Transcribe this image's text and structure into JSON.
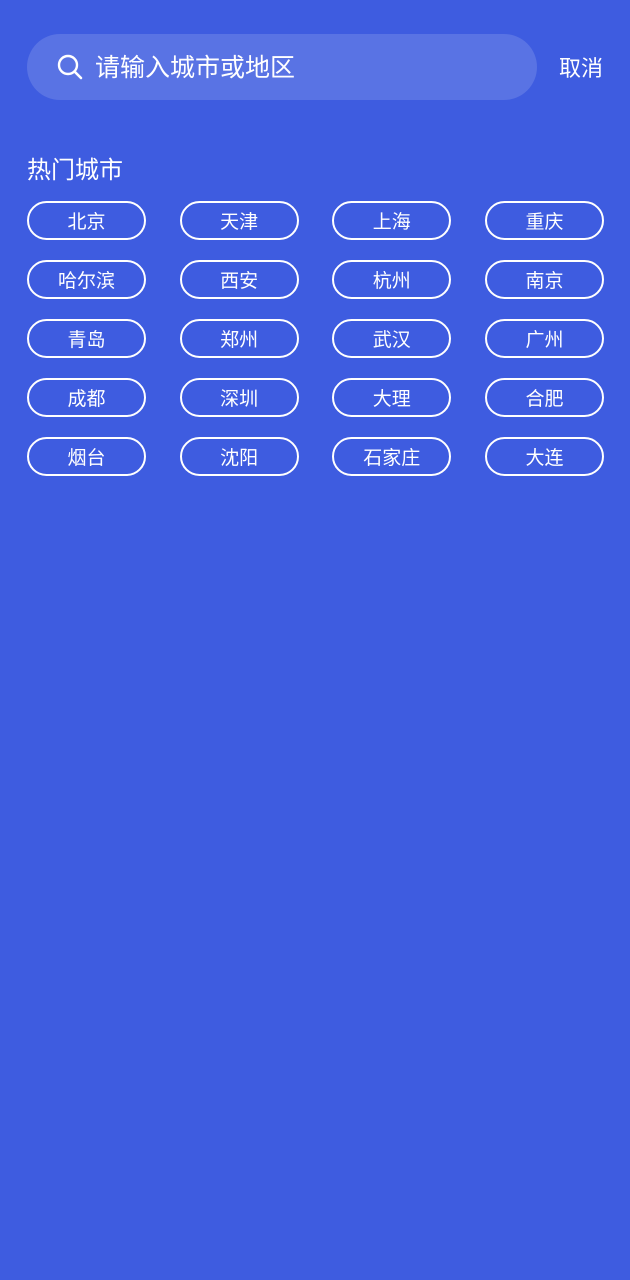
{
  "search": {
    "placeholder": "请输入城市或地区",
    "cancel_label": "取消",
    "icon": "search-icon"
  },
  "hot_cities": {
    "title": "热门城市",
    "cities": [
      "北京",
      "天津",
      "上海",
      "重庆",
      "哈尔滨",
      "西安",
      "杭州",
      "南京",
      "青岛",
      "郑州",
      "武汉",
      "广州",
      "成都",
      "深圳",
      "大理",
      "合肥",
      "烟台",
      "沈阳",
      "石家庄",
      "大连"
    ]
  },
  "colors": {
    "background": "#3E5CE0",
    "text": "#FFFFFF"
  }
}
